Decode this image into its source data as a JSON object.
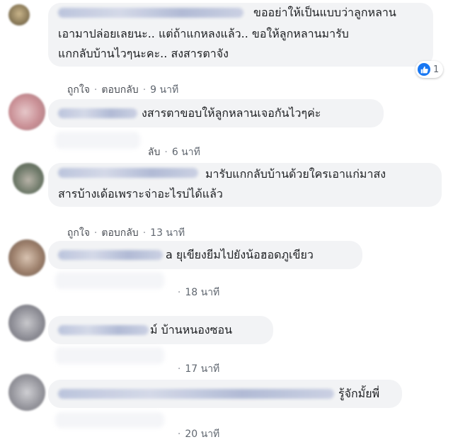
{
  "colors": {
    "bubble": "#f2f3f5",
    "link": "#4b4f56",
    "meta": "#606770",
    "like_blue": "#1877f2"
  },
  "comments": [
    {
      "text_lines": [
        "ขออย่าให้เป็นแบบว่าลูกหลาน",
        "เอามาปล่อยเลยนะ.. แต่ถ้าแกหลงแล้ว.. ขอให้ลูกหลานมารับ",
        "แกกลับบ้านไวๆนะคะ.. สงสารตาจัง"
      ],
      "like_label": "ถูกใจ",
      "reply_label": "ตอบกลับ",
      "time": "9 นาที",
      "reaction_count": "1",
      "reaction_icon": "like-icon"
    },
    {
      "text_lines": [
        "งสารตาขอบให้ลูกหลานเจอกันไวๆค่ะ"
      ],
      "reply_label": "ลับ",
      "time": "6 นาที"
    },
    {
      "text_lines": [
        "มารับแกกลับบ้านด้วยใครเอาแก่มาสง",
        "สารบ้างเด้อเพราะจ่าอะไรบ่ได้แล้ว"
      ],
      "like_label": "ถูกใจ",
      "reply_label": "ตอบกลับ",
      "time": "13 นาที"
    },
    {
      "text_lines": [
        "a ยุเขียงยีมไปยังน้อฮอดภูเขียว"
      ],
      "time": "18 นาที"
    },
    {
      "text_lines": [
        "ม์ บ้านหนองซอน"
      ],
      "time": "17 นาที"
    },
    {
      "text_lines": [
        "รู้จักมั้ยพี่"
      ],
      "time": "20 นาที"
    }
  ]
}
